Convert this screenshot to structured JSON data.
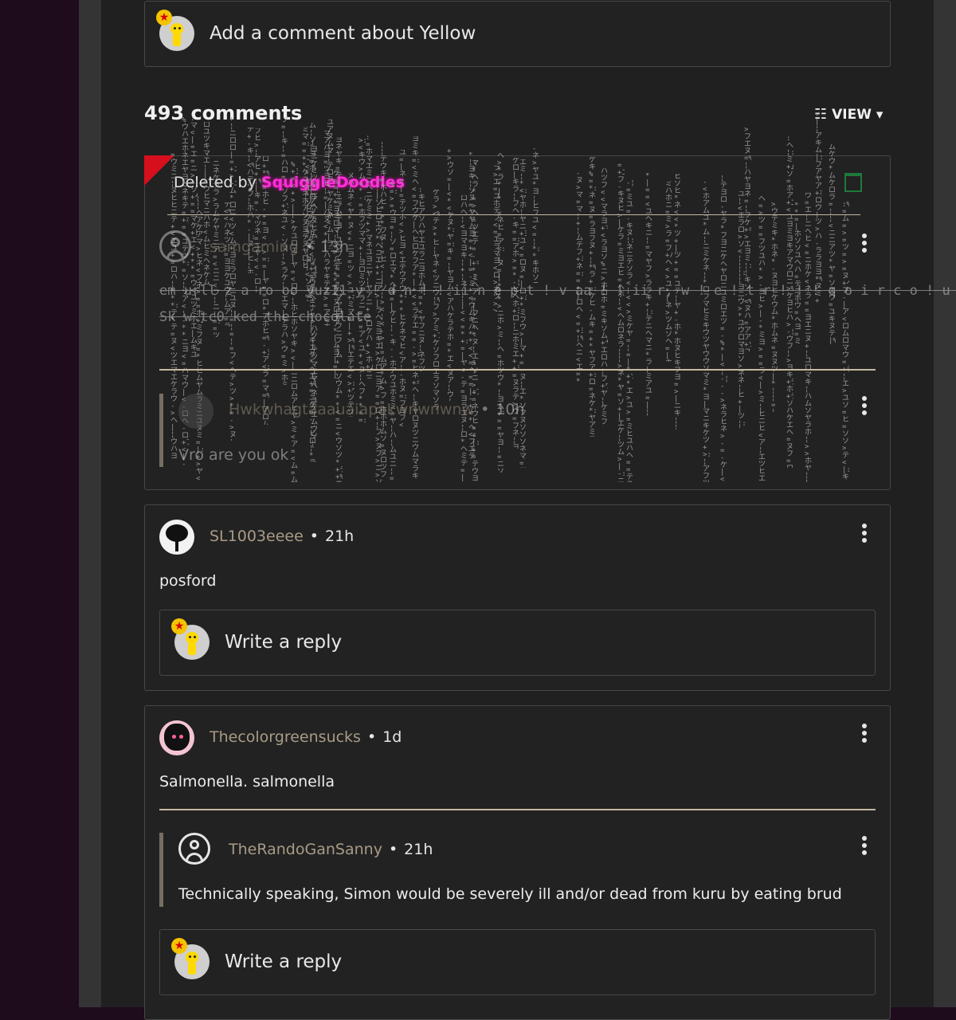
{
  "compose": {
    "placeholder": "Add a comment about Yellow"
  },
  "comments_header": {
    "count": "493 comments",
    "view_label": "VIEW",
    "view_caret": "▾",
    "filter_icon": "sliders-icon"
  },
  "deleted_thread": {
    "deleted_prefix": "Deleted by",
    "deleted_by": "SquiggleDoodles",
    "parent": {
      "username": "samgaming",
      "time": "13h",
      "text_line1": "em urll z a ro oo yuz11 y ! d n ! ! ii n e p t ! v aa ! ! ii r, w ! e ! t r ! ! ! q o i r c o ! u ! ! ! ! c",
      "text_line2": "Sk w tc0 ked the chocolate"
    },
    "reply": {
      "username": "Hwkwhagtaaauaiapakwnwnwnw",
      "time": "10h",
      "text": "Vro are you ok"
    },
    "glitch_chars": "ニ¦ロ=ミツ|ヨ<キ=ラ*フ+ヌ-ハ|テ>ヘ%エ¦ソ:ホ=ケ<マ+ム*ア-ウ|ヤ=ユ:ヒ>ネ¦"
  },
  "comments": [
    {
      "username": "SL1003eeee",
      "time": "21h",
      "text": "posford",
      "reply_placeholder": "Write a reply"
    },
    {
      "username": "Thecolorgreensucks",
      "time": "1d",
      "text": "Salmonella. salmonella",
      "reply": {
        "username": "TheRandoGanSanny",
        "time": "21h",
        "text": "Technically speaking, Simon would be severely ill and/or dead from kuru by eating brud"
      },
      "reply_placeholder": "Write a reply"
    }
  ],
  "colors": {
    "page_bg": "#202020",
    "outer_bg": "#1e0b1c",
    "username": "#a89b87",
    "divider": "#c5b9a2",
    "deleted_name": "#ff2fd8",
    "trash_green": "#1e7a3a"
  }
}
